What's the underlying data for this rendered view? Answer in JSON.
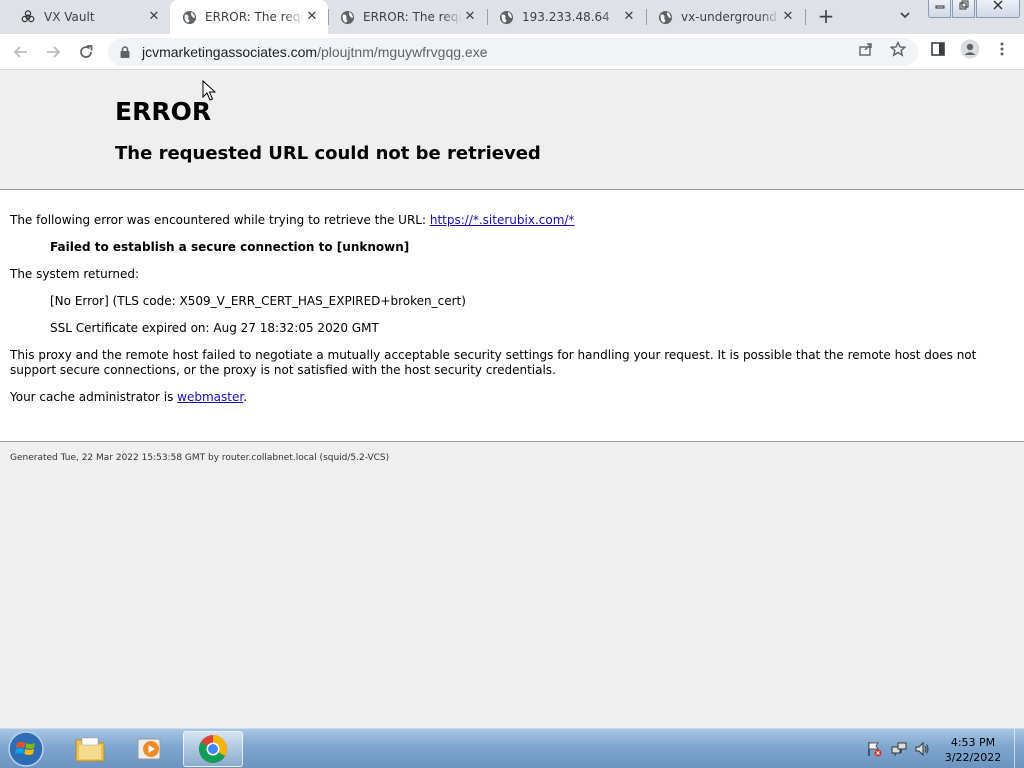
{
  "browser": {
    "tabs": [
      {
        "title": "VX Vault",
        "icon": "biohazard-icon",
        "active": false
      },
      {
        "title": "ERROR: The requested URL could not be retrieved",
        "icon": "globe-icon",
        "active": true
      },
      {
        "title": "ERROR: The requested URL could not be retrieved",
        "icon": "globe-icon",
        "active": false
      },
      {
        "title": "193.233.48.64",
        "icon": "globe-icon",
        "active": false
      },
      {
        "title": "vx-underground",
        "icon": "globe-icon",
        "active": false
      }
    ],
    "new_tab_symbol": "+",
    "address": {
      "domain": "jcvmarketingassociates.com",
      "path": "/ploujtnm/mguywfrvgqg.exe"
    }
  },
  "page": {
    "heading": "ERROR",
    "subheading": "The requested URL could not be retrieved",
    "intro_text": "The following error was encountered while trying to retrieve the URL: ",
    "intro_link": "https://*.siterubix.com/*",
    "error_title": "Failed to establish a secure connection to [unknown]",
    "system_returned": "The system returned:",
    "tls_error": "[No Error] (TLS code: X509_V_ERR_CERT_HAS_EXPIRED+broken_cert)",
    "cert_expired": "SSL Certificate expired on: Aug 27 18:32:05 2020 GMT",
    "explanation": "This proxy and the remote host failed to negotiate a mutually acceptable security settings for handling your request. It is possible that the remote host does not support secure connections, or the proxy is not satisfied with the host security credentials.",
    "admin_text": "Your cache administrator is ",
    "admin_link": "webmaster",
    "admin_suffix": ".",
    "footer": "Generated Tue, 22 Mar 2022 15:53:58 GMT by router.collabnet.local (squid/5.2-VCS)"
  },
  "taskbar": {
    "items": [
      {
        "name": "windows-explorer",
        "icon": "folder-icon",
        "active": false
      },
      {
        "name": "media-player",
        "icon": "media-player-icon",
        "active": false
      },
      {
        "name": "chrome",
        "icon": "chrome-icon",
        "active": true
      }
    ],
    "clock_time": "4:53 PM",
    "clock_date": "3/22/2022"
  },
  "colors": {
    "link": "#1a0dab",
    "page_header_bg": "#efefef",
    "tabstrip_bg": "#dee1e6"
  }
}
